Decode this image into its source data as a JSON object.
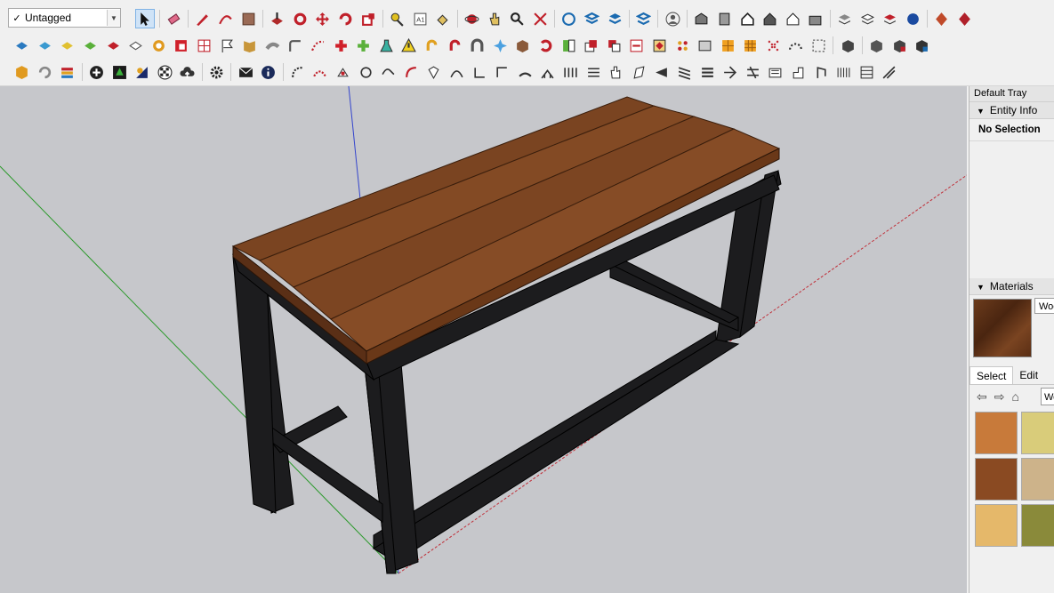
{
  "toolbar": {
    "tag_dropdown": {
      "selected": "Untagged",
      "check": "✓"
    }
  },
  "tray": {
    "title": "Default Tray",
    "entity_info": {
      "header": "Entity Info",
      "selection": "No Selection"
    },
    "materials": {
      "header": "Materials",
      "name_field": "Wood",
      "tabs": [
        "Select",
        "Edit"
      ],
      "library_field": "Wood",
      "swatch_colors": [
        "#c87a3a",
        "#d9cc7a",
        "#8a4a22",
        "#cdb38a",
        "#e5b86a",
        "#8a8a3a"
      ]
    }
  },
  "colors": {
    "viewport_bg": "#c6c7cb",
    "wood": "#7a4421",
    "frame": "#1c1c1e",
    "axis_red": "#c0303a",
    "axis_green": "#2c9a2c",
    "axis_blue": "#3344cc"
  }
}
